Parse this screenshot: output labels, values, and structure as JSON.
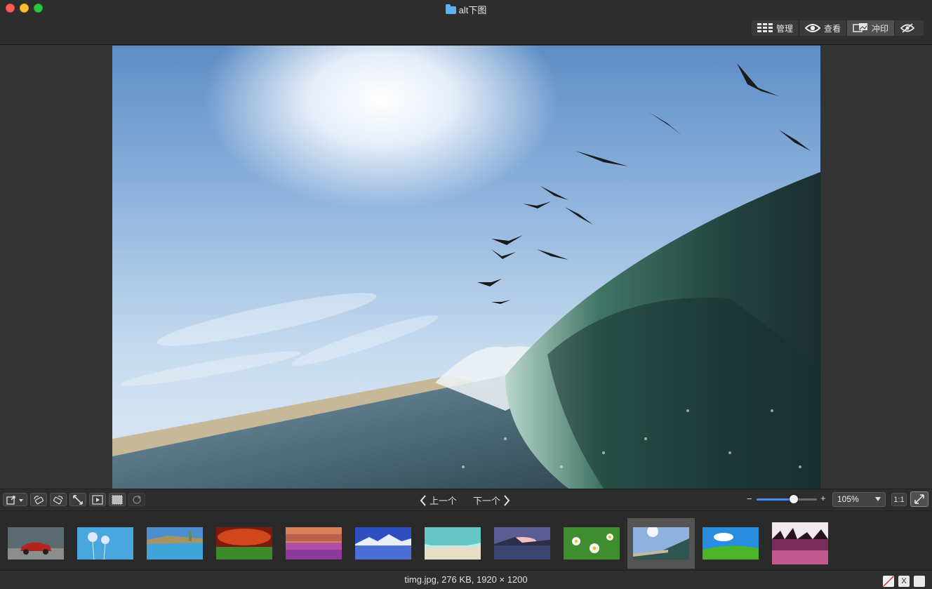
{
  "window": {
    "title": "alt下图"
  },
  "modes": {
    "manage_label": "管理",
    "view_label": "查看",
    "print_label": "冲印"
  },
  "navigation": {
    "prev_label": "上一个",
    "next_label": "下一个"
  },
  "zoom": {
    "minus": "−",
    "plus": "+",
    "slider_level": 0.62,
    "value": "105%",
    "actual_size_label": "1:1"
  },
  "filmstrip": {
    "thumbnails": [
      {
        "name": "car-garage"
      },
      {
        "name": "dandelions"
      },
      {
        "name": "river-landscape"
      },
      {
        "name": "red-sky-field"
      },
      {
        "name": "pink-flower-field"
      },
      {
        "name": "mountain-lake-blue"
      },
      {
        "name": "turquoise-beach"
      },
      {
        "name": "sunset-lake"
      },
      {
        "name": "daisies"
      },
      {
        "name": "wave-birds",
        "selected": true
      },
      {
        "name": "green-meadow"
      },
      {
        "name": "pink-lake-trees"
      }
    ]
  },
  "status": {
    "file_info": "timg.jpg, 276 KB, 1920 × 1200",
    "x_label": "X"
  },
  "colors": {
    "accent": "#3d8bff",
    "background": "#333333"
  }
}
